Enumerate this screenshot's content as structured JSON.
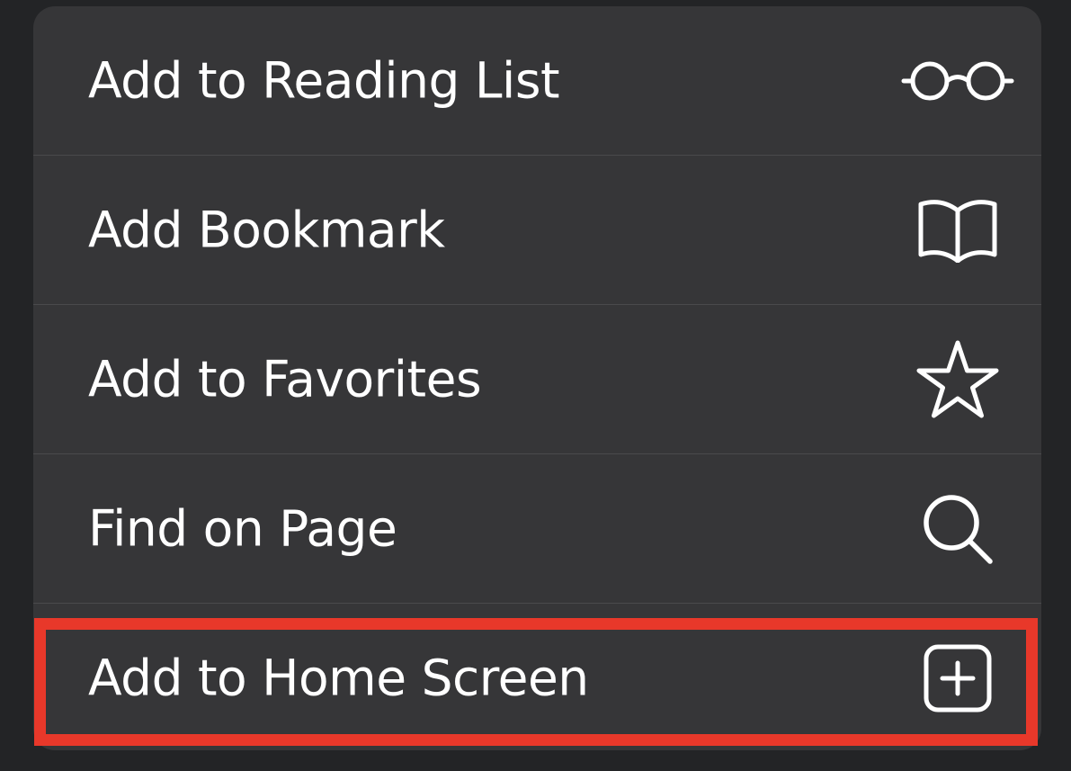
{
  "menu": {
    "items": [
      {
        "label": "Add to Reading List",
        "icon": "glasses-icon"
      },
      {
        "label": "Add Bookmark",
        "icon": "book-icon"
      },
      {
        "label": "Add to Favorites",
        "icon": "star-icon"
      },
      {
        "label": "Find on Page",
        "icon": "magnifying-glass-icon"
      },
      {
        "label": "Add to Home Screen",
        "icon": "plus-square-icon"
      }
    ],
    "highlighted_item": "Add to Home Screen"
  },
  "colors": {
    "background": "#232426",
    "menu_background": "#363638",
    "divider": "#4a4a4c",
    "text": "#ffffff",
    "highlight_border": "#e8382a"
  }
}
